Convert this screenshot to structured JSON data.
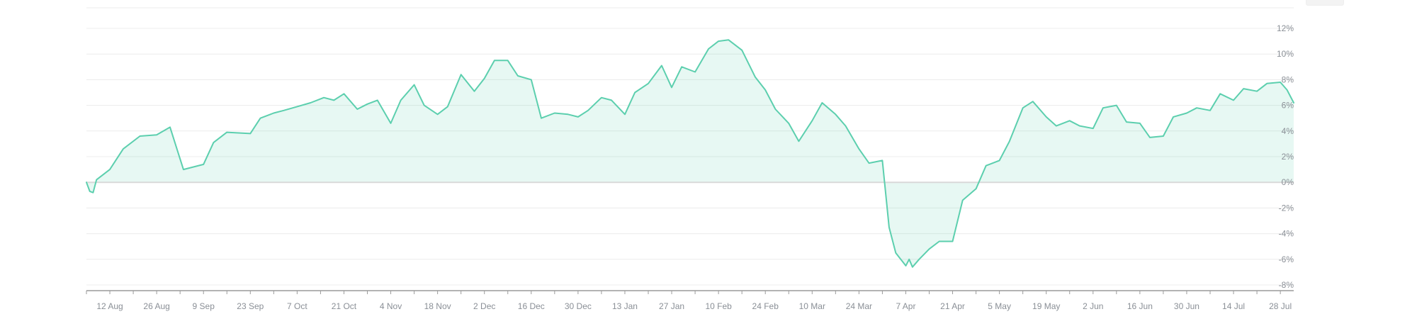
{
  "chart_data": {
    "type": "area",
    "title": "",
    "xlabel": "",
    "ylabel": "",
    "y_ticks": [
      "12%",
      "10%",
      "8%",
      "6%",
      "4%",
      "2%",
      "0%",
      "-2%",
      "-4%",
      "-6%",
      "-8%"
    ],
    "ylim": [
      -8,
      13.6
    ],
    "x_ticks": [
      "12 Aug",
      "26 Aug",
      "9 Sep",
      "23 Sep",
      "7 Oct",
      "21 Oct",
      "4 Nov",
      "18 Nov",
      "2 Dec",
      "16 Dec",
      "30 Dec",
      "13 Jan",
      "27 Jan",
      "10 Feb",
      "24 Feb",
      "10 Mar",
      "24 Mar",
      "7 Apr",
      "21 Apr",
      "5 May",
      "19 May",
      "2 Jun",
      "16 Jun",
      "30 Jun",
      "14 Jul",
      "28 Jul"
    ],
    "grid": true,
    "legend": "none",
    "color": "#5ccfae",
    "series": [
      {
        "x": [
          "2024-08-05",
          "2024-08-06",
          "2024-08-07",
          "2024-08-08",
          "2024-08-12",
          "2024-08-16",
          "2024-08-21",
          "2024-08-26",
          "2024-08-30",
          "2024-09-03",
          "2024-09-09",
          "2024-09-12",
          "2024-09-16",
          "2024-09-23",
          "2024-09-26",
          "2024-09-30",
          "2024-10-03",
          "2024-10-07",
          "2024-10-11",
          "2024-10-15",
          "2024-10-18",
          "2024-10-21",
          "2024-10-25",
          "2024-10-28",
          "2024-10-31",
          "2024-11-04",
          "2024-11-07",
          "2024-11-11",
          "2024-11-14",
          "2024-11-18",
          "2024-11-21",
          "2024-11-25",
          "2024-11-29",
          "2024-12-02",
          "2024-12-05",
          "2024-12-09",
          "2024-12-12",
          "2024-12-16",
          "2024-12-19",
          "2024-12-23",
          "2024-12-27",
          "2024-12-30",
          "2025-01-02",
          "2025-01-06",
          "2025-01-09",
          "2025-01-13",
          "2025-01-16",
          "2025-01-20",
          "2025-01-24",
          "2025-01-27",
          "2025-01-30",
          "2025-02-03",
          "2025-02-07",
          "2025-02-10",
          "2025-02-13",
          "2025-02-17",
          "2025-02-21",
          "2025-02-24",
          "2025-02-27",
          "2025-03-03",
          "2025-03-06",
          "2025-03-10",
          "2025-03-13",
          "2025-03-17",
          "2025-03-20",
          "2025-03-24",
          "2025-03-27",
          "2025-03-31",
          "2025-04-02",
          "2025-04-04",
          "2025-04-07",
          "2025-04-08",
          "2025-04-09",
          "2025-04-11",
          "2025-04-14",
          "2025-04-17",
          "2025-04-21",
          "2025-04-24",
          "2025-04-28",
          "2025-05-01",
          "2025-05-05",
          "2025-05-08",
          "2025-05-12",
          "2025-05-15",
          "2025-05-19",
          "2025-05-22",
          "2025-05-26",
          "2025-05-29",
          "2025-06-02",
          "2025-06-05",
          "2025-06-09",
          "2025-06-12",
          "2025-06-16",
          "2025-06-19",
          "2025-06-23",
          "2025-06-26",
          "2025-06-30",
          "2025-07-03",
          "2025-07-07",
          "2025-07-10",
          "2025-07-14",
          "2025-07-17",
          "2025-07-21",
          "2025-07-24",
          "2025-07-28",
          "2025-07-30",
          "2025-08-01"
        ],
        "values": [
          0,
          -0.7,
          -0.8,
          0.2,
          1.0,
          2.6,
          3.6,
          3.7,
          4.3,
          1.0,
          1.4,
          3.1,
          3.9,
          3.8,
          5.0,
          5.4,
          5.6,
          5.9,
          6.2,
          6.6,
          6.4,
          6.9,
          5.7,
          6.1,
          6.4,
          4.6,
          6.4,
          7.6,
          6.0,
          5.3,
          5.9,
          8.4,
          7.1,
          8.1,
          9.5,
          9.5,
          8.3,
          8.0,
          5.0,
          5.4,
          5.3,
          5.1,
          5.6,
          6.6,
          6.4,
          5.3,
          7.0,
          7.7,
          9.1,
          7.4,
          9.0,
          8.6,
          10.4,
          11.0,
          11.1,
          10.3,
          8.2,
          7.2,
          5.7,
          4.6,
          3.2,
          4.8,
          6.2,
          5.3,
          4.4,
          2.6,
          1.5,
          1.7,
          -3.5,
          -5.5,
          -6.5,
          -6.0,
          -6.6,
          -6.0,
          -5.2,
          -4.6,
          -4.6,
          -1.4,
          -0.5,
          1.3,
          1.7,
          3.2,
          5.8,
          6.3,
          5.1,
          4.4,
          4.8,
          4.4,
          4.2,
          5.8,
          6.0,
          4.7,
          4.6,
          3.5,
          3.6,
          5.1,
          5.4,
          5.8,
          5.6,
          6.9,
          6.4,
          7.3,
          7.1,
          7.7,
          7.8,
          7.2,
          6.2
        ]
      }
    ]
  }
}
